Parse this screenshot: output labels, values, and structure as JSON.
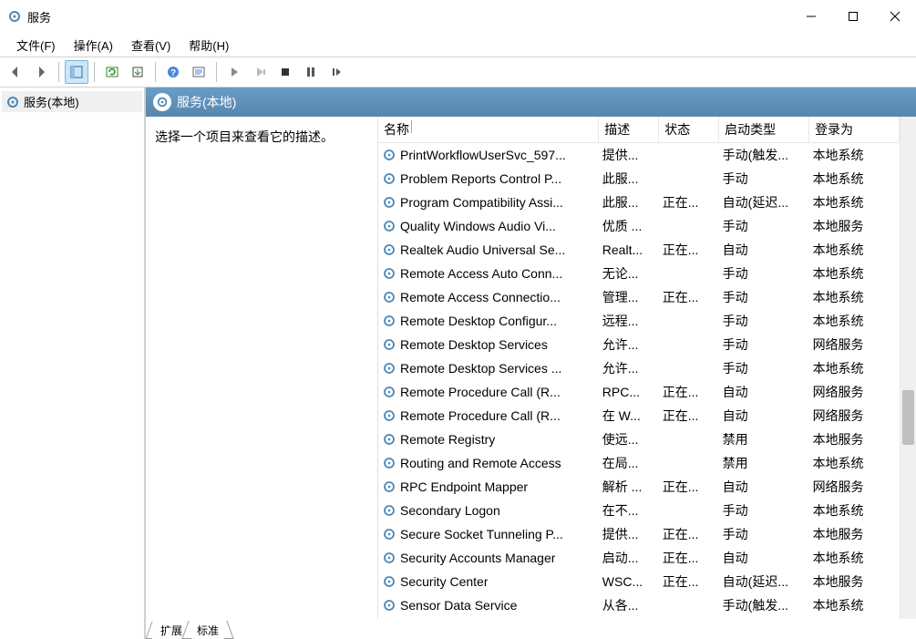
{
  "window": {
    "title": "服务"
  },
  "menus": {
    "file": "文件(F)",
    "action": "操作(A)",
    "view": "查看(V)",
    "help": "帮助(H)"
  },
  "tree": {
    "root": "服务(本地)"
  },
  "panel": {
    "title": "服务(本地)",
    "description": "选择一个项目来查看它的描述。"
  },
  "columns": {
    "name": "名称",
    "desc": "描述",
    "status": "状态",
    "startup": "启动类型",
    "logon": "登录为"
  },
  "tabs": {
    "extended": "扩展",
    "standard": "标准"
  },
  "services": [
    {
      "name": "PrintWorkflowUserSvc_597...",
      "desc": "提供...",
      "status": "",
      "startup": "手动(触发...",
      "logon": "本地系统"
    },
    {
      "name": "Problem Reports Control P...",
      "desc": "此服...",
      "status": "",
      "startup": "手动",
      "logon": "本地系统"
    },
    {
      "name": "Program Compatibility Assi...",
      "desc": "此服...",
      "status": "正在...",
      "startup": "自动(延迟...",
      "logon": "本地系统"
    },
    {
      "name": "Quality Windows Audio Vi...",
      "desc": "优质 ...",
      "status": "",
      "startup": "手动",
      "logon": "本地服务"
    },
    {
      "name": "Realtek Audio Universal Se...",
      "desc": "Realt...",
      "status": "正在...",
      "startup": "自动",
      "logon": "本地系统"
    },
    {
      "name": "Remote Access Auto Conn...",
      "desc": "无论...",
      "status": "",
      "startup": "手动",
      "logon": "本地系统"
    },
    {
      "name": "Remote Access Connectio...",
      "desc": "管理...",
      "status": "正在...",
      "startup": "手动",
      "logon": "本地系统"
    },
    {
      "name": "Remote Desktop Configur...",
      "desc": "远程...",
      "status": "",
      "startup": "手动",
      "logon": "本地系统"
    },
    {
      "name": "Remote Desktop Services",
      "desc": "允许...",
      "status": "",
      "startup": "手动",
      "logon": "网络服务"
    },
    {
      "name": "Remote Desktop Services ...",
      "desc": "允许...",
      "status": "",
      "startup": "手动",
      "logon": "本地系统"
    },
    {
      "name": "Remote Procedure Call (R...",
      "desc": "RPC...",
      "status": "正在...",
      "startup": "自动",
      "logon": "网络服务"
    },
    {
      "name": "Remote Procedure Call (R...",
      "desc": "在 W...",
      "status": "正在...",
      "startup": "自动",
      "logon": "网络服务"
    },
    {
      "name": "Remote Registry",
      "desc": "使远...",
      "status": "",
      "startup": "禁用",
      "logon": "本地服务"
    },
    {
      "name": "Routing and Remote Access",
      "desc": "在局...",
      "status": "",
      "startup": "禁用",
      "logon": "本地系统"
    },
    {
      "name": "RPC Endpoint Mapper",
      "desc": "解析 ...",
      "status": "正在...",
      "startup": "自动",
      "logon": "网络服务"
    },
    {
      "name": "Secondary Logon",
      "desc": "在不...",
      "status": "",
      "startup": "手动",
      "logon": "本地系统"
    },
    {
      "name": "Secure Socket Tunneling P...",
      "desc": "提供...",
      "status": "正在...",
      "startup": "手动",
      "logon": "本地服务"
    },
    {
      "name": "Security Accounts Manager",
      "desc": "启动...",
      "status": "正在...",
      "startup": "自动",
      "logon": "本地系统"
    },
    {
      "name": "Security Center",
      "desc": "WSC...",
      "status": "正在...",
      "startup": "自动(延迟...",
      "logon": "本地服务"
    },
    {
      "name": "Sensor Data Service",
      "desc": "从各...",
      "status": "",
      "startup": "手动(触发...",
      "logon": "本地系统"
    }
  ]
}
